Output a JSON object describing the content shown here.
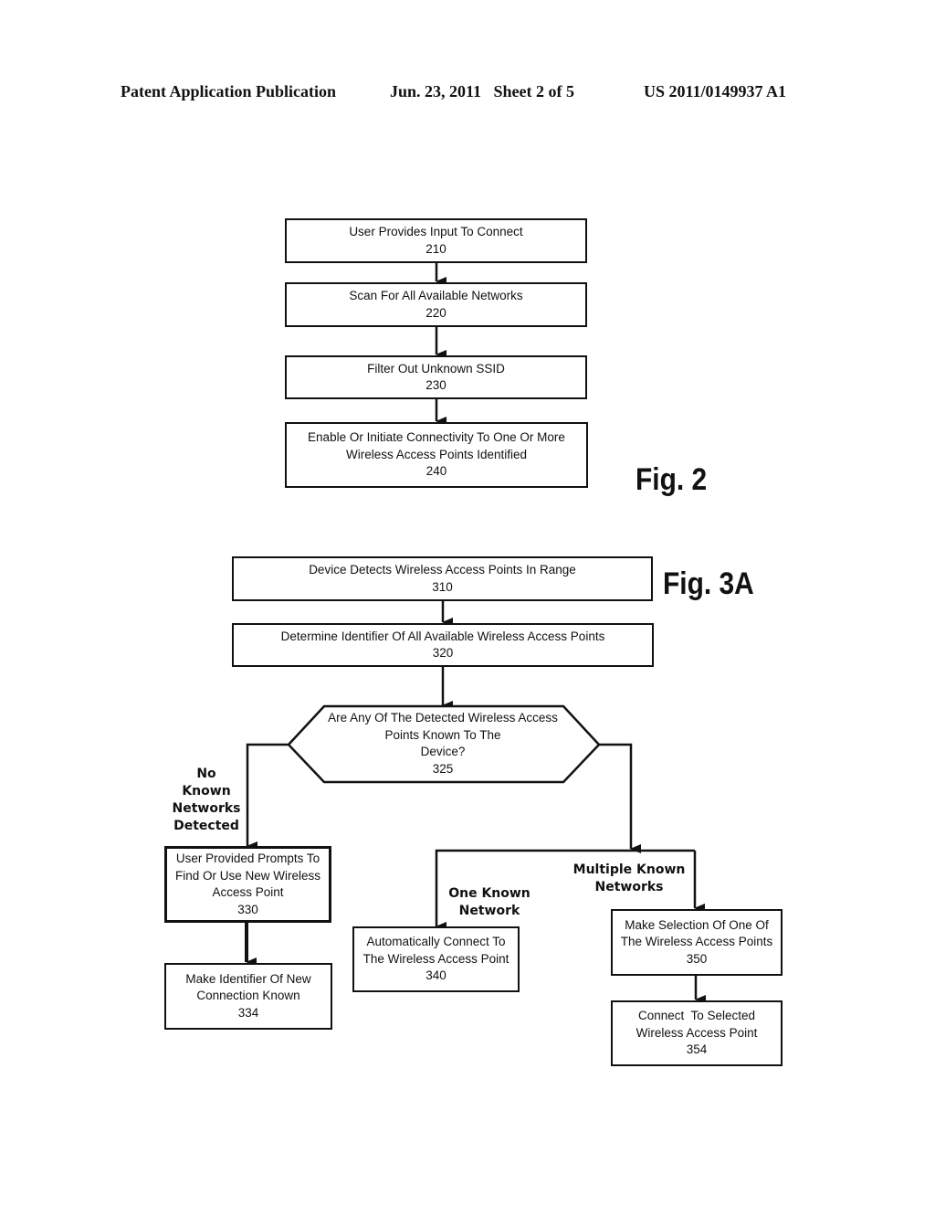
{
  "header": {
    "publication": "Patent Application Publication",
    "date_sheet": "Jun. 23, 2011   Sheet 2 of 5",
    "number": "US 2011/0149937 A1"
  },
  "fig2": {
    "label": "Fig. 2",
    "steps": [
      {
        "text": "User Provides Input To Connect",
        "ref": "210"
      },
      {
        "text": "Scan For All Available Networks",
        "ref": "220"
      },
      {
        "text": "Filter Out Unknown SSID",
        "ref": "230"
      },
      {
        "text_line1": "Enable Or Initiate Connectivity To One Or More",
        "text_line2": "Wireless Access Points Identified",
        "ref": "240"
      }
    ]
  },
  "fig3a": {
    "label": "Fig. 3A",
    "step310": {
      "text": "Device Detects Wireless Access Points In Range",
      "ref": "310"
    },
    "step320": {
      "text": "Determine Identifier Of All Available Wireless Access Points",
      "ref": "320"
    },
    "decision325": {
      "line1": "Are Any Of The Detected Wireless Access",
      "line2": "Points Known To The",
      "line3": "Device?",
      "ref": "325"
    },
    "branch_none": {
      "line1": "No",
      "line2": "Known",
      "line3": "Networks",
      "line4": "Detected"
    },
    "branch_one": {
      "line1": "One Known",
      "line2": "Network"
    },
    "branch_multiple": {
      "line1": "Multiple Known",
      "line2": "Networks"
    },
    "step330": {
      "line1": "User Provided Prompts To",
      "line2": "Find Or Use New Wireless",
      "line3": "Access Point",
      "ref": "330"
    },
    "step334": {
      "line1": "Make Identifier Of New",
      "line2": "Connection Known",
      "ref": "334"
    },
    "step340": {
      "line1": "Automatically Connect To",
      "line2": "The Wireless Access Point",
      "ref": "340"
    },
    "step350": {
      "line1": "Make Selection Of One Of",
      "line2": "The Wireless Access Points",
      "ref": "350"
    },
    "step354": {
      "line1": "Connect  To Selected",
      "line2": "Wireless Access Point",
      "ref": "354"
    }
  }
}
